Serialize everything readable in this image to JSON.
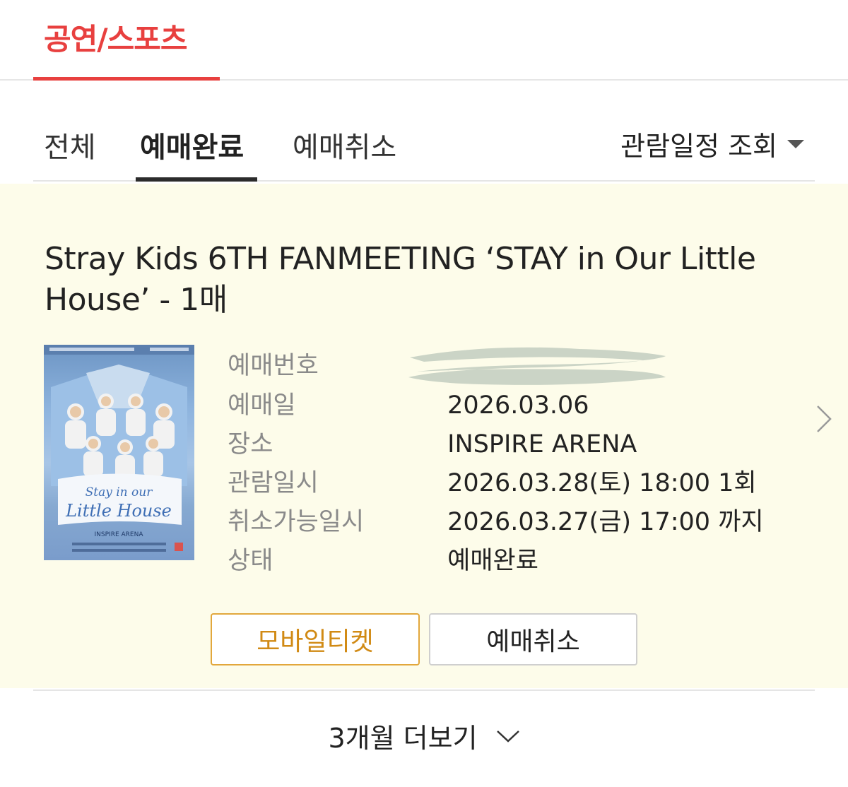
{
  "header": {
    "category_tab": "공연/스포츠"
  },
  "filters": {
    "tabs": [
      {
        "label": "전체",
        "active": false
      },
      {
        "label": "예매완료",
        "active": true
      },
      {
        "label": "예매취소",
        "active": false
      }
    ],
    "schedule_dropdown": "관람일정 조회"
  },
  "booking": {
    "title": "Stray Kids 6TH FANMEETING ‘STAY in Our Little House’",
    "quantity": "- 1매",
    "details": [
      {
        "label": "예매번호",
        "value": ""
      },
      {
        "label": "예매일",
        "value": "2026.03.06"
      },
      {
        "label": "장소",
        "value": "INSPIRE ARENA"
      },
      {
        "label": "관람일시",
        "value": "2026.03.28(토) 18:00 1회"
      },
      {
        "label": "취소가능일시",
        "value": "2026.03.27(금) 17:00 까지"
      },
      {
        "label": "상태",
        "value": "예매완료"
      }
    ],
    "mobile_ticket_button": "모바일티켓",
    "cancel_button": "예매취소",
    "poster": {
      "logo_text": "Stay in our Little House",
      "venue_text": "INSPIRE ARENA"
    }
  },
  "footer": {
    "more_label": "3개월 더보기"
  },
  "colors": {
    "accent_red": "#e8403f",
    "card_background": "#fdfcea",
    "mobile_ticket_border": "#e2a73c"
  }
}
